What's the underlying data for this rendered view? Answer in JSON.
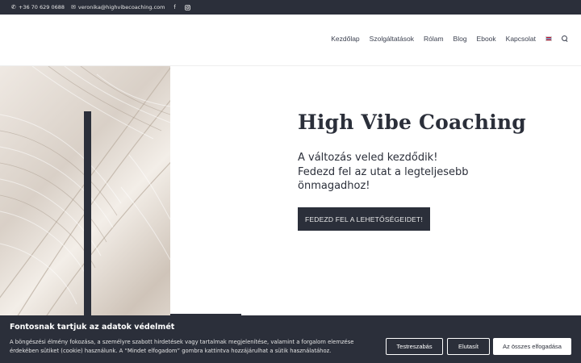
{
  "topbar": {
    "phone": "+36 70 629 0688",
    "email": "veronika@highvibecoaching.com",
    "phone_icon": "phone-icon",
    "email_icon": "envelope-icon",
    "social": [
      "facebook-icon",
      "instagram-icon"
    ]
  },
  "nav": {
    "items": [
      "Kezdőlap",
      "Szolgáltatások",
      "Rólam",
      "Blog",
      "Ebook",
      "Kapcsolat"
    ],
    "language_icon": "uk-flag-icon",
    "search_icon": "search-icon"
  },
  "hero": {
    "title": "High Vibe Coaching",
    "subtitle_lines": [
      "A változás veled kezdődik!",
      "Fedezd fel az utat a legteljesebb",
      "önmagadhoz!"
    ],
    "cta_label": "FEDEZD FEL A LEHETŐSÉGEIDET!"
  },
  "cookie": {
    "title": "Fontosnak tartjuk az adatok védelmét",
    "text": "A böngészési élmény fokozása, a személyre szabott hirdetések vagy tartalmak megjelenítése, valamint a forgalom elemzése érdekében sütiket (cookie) használunk. A “Mindet elfogadom” gombra kattintva hozzájárulhat a sütik használatához.",
    "customize_label": "Testreszabás",
    "reject_label": "Elutasít",
    "accept_label": "Az összes elfogadása"
  },
  "colors": {
    "dark": "#2b2f3a",
    "white": "#ffffff"
  }
}
